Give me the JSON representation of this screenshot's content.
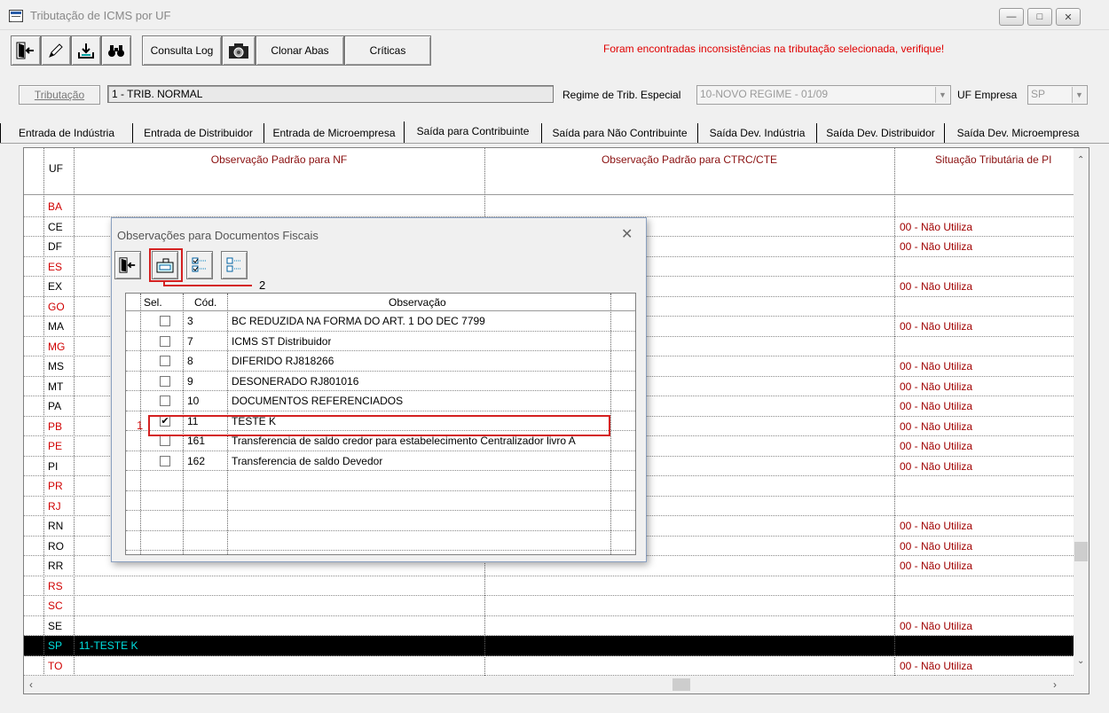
{
  "window": {
    "title": "Tributação de ICMS por UF"
  },
  "toolbar": {
    "exit_icon": "exit-door-icon",
    "edit_icon": "pencil-icon",
    "import_icon": "import-tray-icon",
    "search_icon": "binoculars-icon",
    "consulta_log": "Consulta Log",
    "camera_icon": "camera-icon",
    "clonar_abas": "Clonar Abas",
    "criticas": "Críticas",
    "warning": "Foram encontradas inconsistências na tributação selecionada, verifique!"
  },
  "tributacao": {
    "button": "Tributação",
    "value": "1 - TRIB. NORMAL",
    "regime_label": "Regime de Trib. Especial",
    "regime_value": "10-NOVO REGIME - 01/09",
    "uf_empresa_label": "UF Empresa",
    "uf_empresa_value": "SP"
  },
  "tabs": [
    "Entrada de Indústria",
    "Entrada de Distribuidor",
    "Entrada de Microempresa",
    "Saída para Contribuinte",
    "Saída para Não Contribuinte",
    "Saída Dev. Indústria",
    "Saída Dev. Distribuidor",
    "Saída Dev. Microempresa"
  ],
  "active_tab": "Saída para Contribuinte",
  "grid": {
    "headers": {
      "uf": "UF",
      "obs_nf": "Observação Padrão para NF",
      "obs_ctrc": "Observação Padrão para CTRC/CTE",
      "situacao": "Situação Tributária de PI"
    },
    "rows": [
      {
        "uf": "BA",
        "sit": "",
        "red": true
      },
      {
        "uf": "CE",
        "sit": "00 - Não Utiliza",
        "red": false
      },
      {
        "uf": "DF",
        "sit": "00 - Não Utiliza",
        "red": false
      },
      {
        "uf": "ES",
        "sit": "",
        "red": true
      },
      {
        "uf": "EX",
        "sit": "00 - Não Utiliza",
        "red": false
      },
      {
        "uf": "GO",
        "sit": "",
        "red": true
      },
      {
        "uf": "MA",
        "sit": "00 - Não Utiliza",
        "red": false
      },
      {
        "uf": "MG",
        "sit": "",
        "red": true
      },
      {
        "uf": "MS",
        "sit": "00 - Não Utiliza",
        "red": false
      },
      {
        "uf": "MT",
        "sit": "00 - Não Utiliza",
        "red": false
      },
      {
        "uf": "PA",
        "sit": "00 - Não Utiliza",
        "red": false
      },
      {
        "uf": "PB",
        "sit": "00 - Não Utiliza",
        "red": true
      },
      {
        "uf": "PE",
        "sit": "00 - Não Utiliza",
        "red": true
      },
      {
        "uf": "PI",
        "sit": "00 - Não Utiliza",
        "red": false
      },
      {
        "uf": "PR",
        "sit": "",
        "red": true
      },
      {
        "uf": "RJ",
        "sit": "",
        "red": true
      },
      {
        "uf": "RN",
        "sit": "00 - Não Utiliza",
        "red": false
      },
      {
        "uf": "RO",
        "sit": "00 - Não Utiliza",
        "red": false
      },
      {
        "uf": "RR",
        "sit": "00 - Não Utiliza",
        "red": false
      },
      {
        "uf": "RS",
        "sit": "",
        "red": true
      },
      {
        "uf": "SC",
        "sit": "",
        "red": true
      },
      {
        "uf": "SE",
        "sit": "00 - Não Utiliza",
        "red": false
      },
      {
        "uf": "SP",
        "sit": "",
        "red": false,
        "selected": true,
        "obs": "11-TESTE K"
      },
      {
        "uf": "TO",
        "sit": "00 - Não Utiliza",
        "red": true
      }
    ]
  },
  "modal": {
    "title": "Observações para Documentos Fiscais",
    "close": "✕",
    "buttons": [
      "exit-door-icon",
      "apply-icon",
      "check-all-icon",
      "uncheck-all-icon"
    ],
    "annotation_1": "1",
    "annotation_2": "2",
    "headers": {
      "sel": "Sel.",
      "cod": "Cód.",
      "obs": "Observação"
    },
    "rows": [
      {
        "checked": false,
        "cod": "3",
        "obs": "BC REDUZIDA NA FORMA DO ART. 1 DO DEC 7799"
      },
      {
        "checked": false,
        "cod": "7",
        "obs": "ICMS ST Distribuidor"
      },
      {
        "checked": false,
        "cod": "8",
        "obs": "DIFERIDO RJ818266"
      },
      {
        "checked": false,
        "cod": "9",
        "obs": "DESONERADO RJ801016"
      },
      {
        "checked": false,
        "cod": "10",
        "obs": "DOCUMENTOS REFERENCIADOS"
      },
      {
        "checked": true,
        "cod": "11",
        "obs": "TESTE K"
      },
      {
        "checked": false,
        "cod": "161",
        "obs": "Transferencia de saldo credor para estabelecimento Centralizador livro A"
      },
      {
        "checked": false,
        "cod": "162",
        "obs": "Transferencia de saldo Devedor"
      }
    ]
  },
  "colors": {
    "accent_red": "#d00000",
    "warning_red": "#e00000",
    "selected_row": "#000000",
    "selected_text": "#00e0e0"
  }
}
